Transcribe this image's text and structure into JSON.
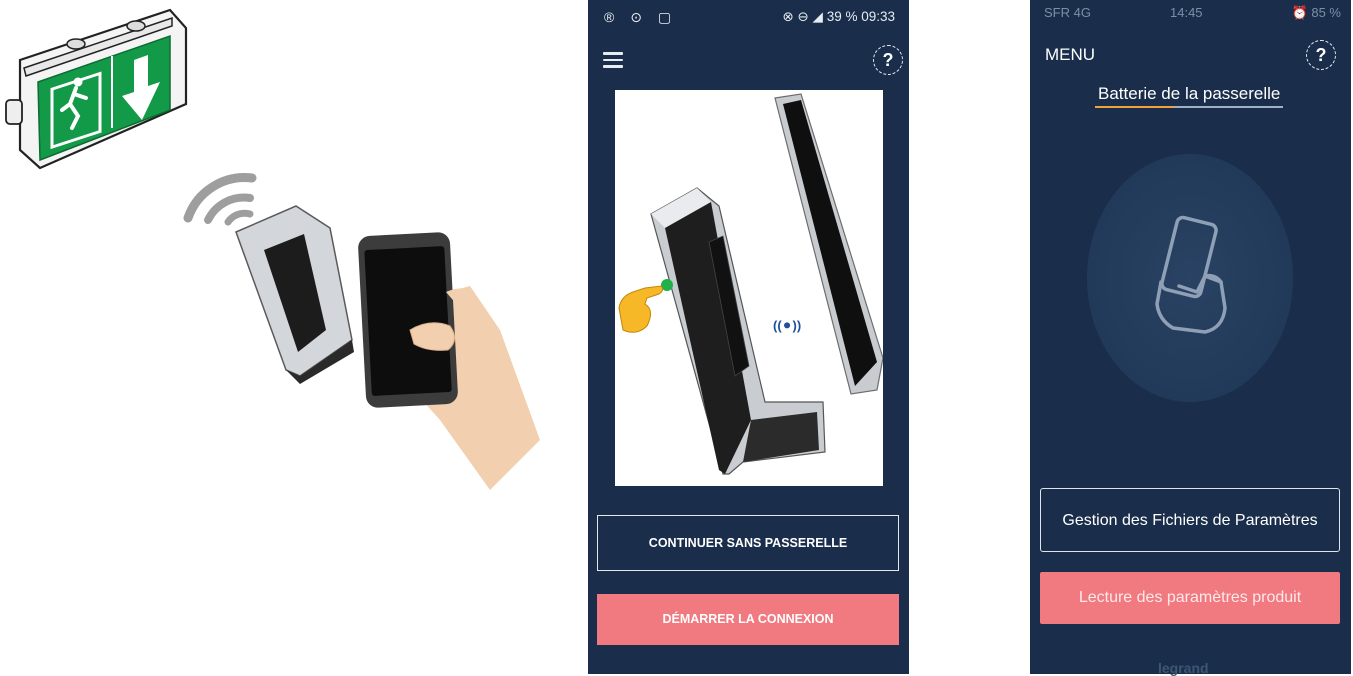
{
  "phone1": {
    "status": {
      "left_icons": "® ⊙ ▢",
      "right": "⊗ ⊖ ◢ 39 % 09:33"
    },
    "menu_icon": "hamburger-icon",
    "help_icon": "?",
    "bluetooth_badge": "((⚫))",
    "buttons": {
      "continue_without_gateway": "CONTINUER SANS PASSERELLE",
      "start_connection": "DÉMARRER LA CONNEXION"
    }
  },
  "phone2": {
    "status": {
      "carrier": "SFR 4G",
      "time": "14:45",
      "battery": "⏰ 85 %"
    },
    "menu_label": "MENU",
    "help_icon": "?",
    "title": "Batterie de la passerelle",
    "buttons": {
      "parameter_files": "Gestion des Fichiers de Paramètres",
      "read_parameters": "Lecture des paramètres produit"
    },
    "brand": "legrand"
  },
  "colors": {
    "app_background": "#1a2d4a",
    "accent_button": "#f07a80",
    "title_underline": "#f0a33a",
    "exit_sign_green": "#139a48"
  }
}
